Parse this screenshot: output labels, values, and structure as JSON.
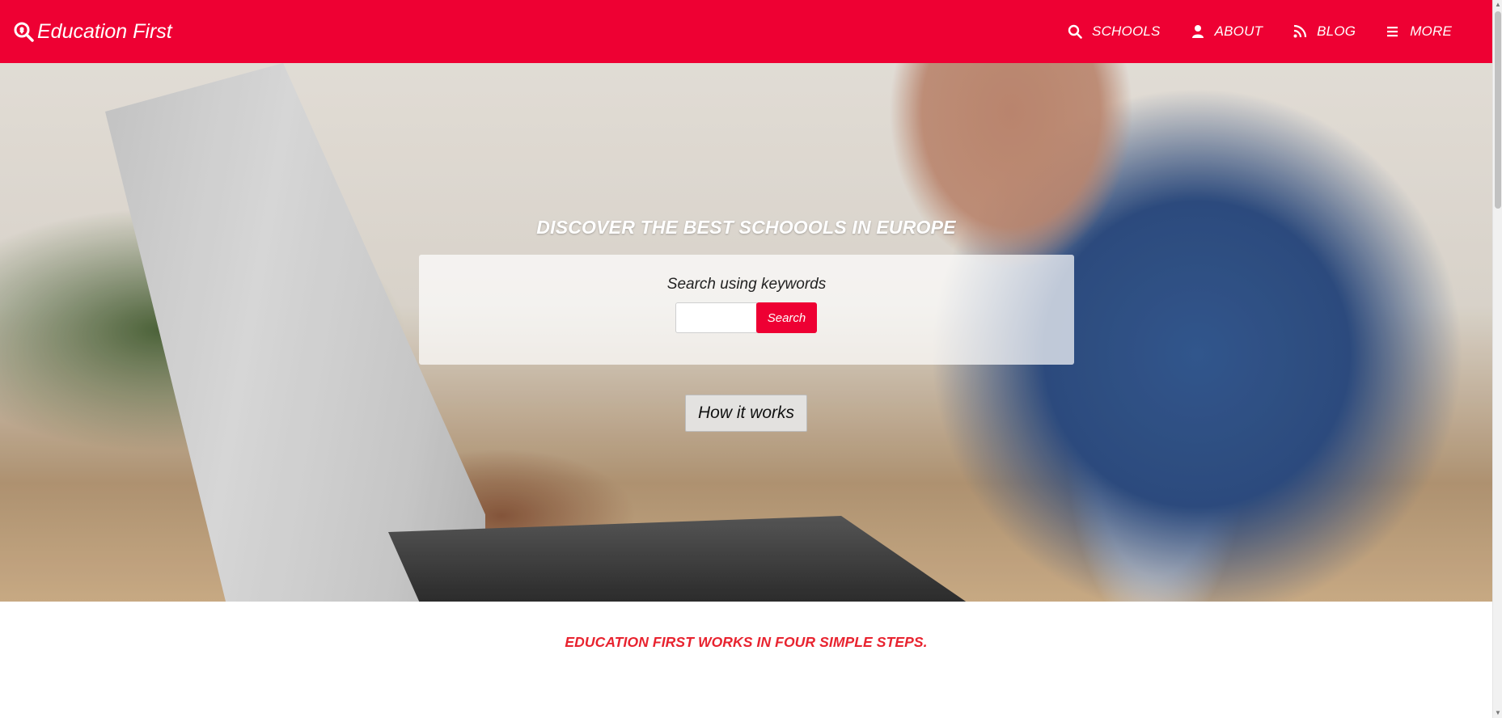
{
  "brand": {
    "name": "Education First",
    "icon": "search-location-icon"
  },
  "nav": {
    "items": [
      {
        "label": "SCHOOLS",
        "icon": "search-icon"
      },
      {
        "label": "ABOUT",
        "icon": "user-icon"
      },
      {
        "label": "BLOG",
        "icon": "rss-icon"
      },
      {
        "label": "MORE",
        "icon": "menu-icon"
      }
    ]
  },
  "hero": {
    "title": "DISCOVER THE BEST SCHOOOLS IN EUROPE",
    "search_label": "Search using keywords",
    "search_value": "",
    "search_button": "Search",
    "how_button": "How it works"
  },
  "steps": {
    "heading": "EDUCATION FIRST WORKS IN FOUR SIMPLE STEPS."
  },
  "colors": {
    "brand": "#ee0033",
    "heading": "#e8232f"
  }
}
